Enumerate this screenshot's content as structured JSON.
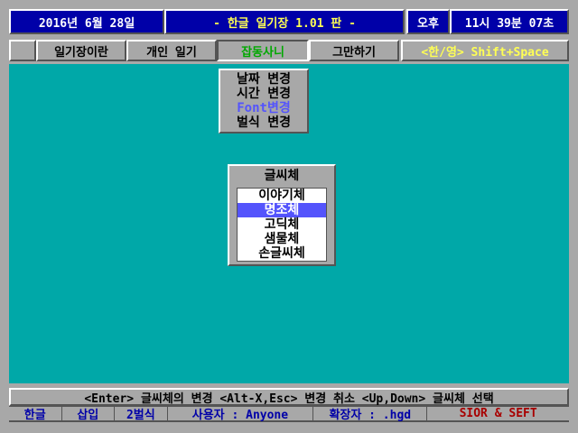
{
  "title_bar": {
    "date": "2016년  6월 28일",
    "app_title": "- 한글 일기장 1.01 판 -",
    "ampm": "오후",
    "time": "11시 39분 07초"
  },
  "menu": {
    "items": [
      "일기장이란",
      "개인 일기",
      "잡동사니",
      "그만하기"
    ],
    "active_index": 2,
    "lang_toggle": "<한/영> Shift+Space"
  },
  "submenu": {
    "items": [
      "날짜 변경",
      "시간 변경",
      "Font변경",
      "벌식 변경"
    ],
    "highlighted_index": 2
  },
  "font_dialog": {
    "title": "글씨체",
    "options": [
      "이야기체",
      "명조체",
      "고딕체",
      "샘물체",
      "손글씨체"
    ],
    "selected_index": 1
  },
  "help_line": "<Enter> 글씨체의 변경   <Alt-X,Esc> 변경 취소   <Up,Down> 글씨체 선택",
  "status_bar": {
    "lang": "한글",
    "mode": "삽입",
    "keyboard": "2벌식",
    "user": "사용자 : Anyone",
    "ext": "확장자 : .hgd",
    "credit": "SIOR & SEFT"
  },
  "colors": {
    "workspace": "#00a8a8",
    "title_bg": "#0000a8",
    "selected": "#5454fc",
    "active_menu": "#00a800",
    "accent_yellow": "#ffff54",
    "credit_red": "#a80000"
  }
}
